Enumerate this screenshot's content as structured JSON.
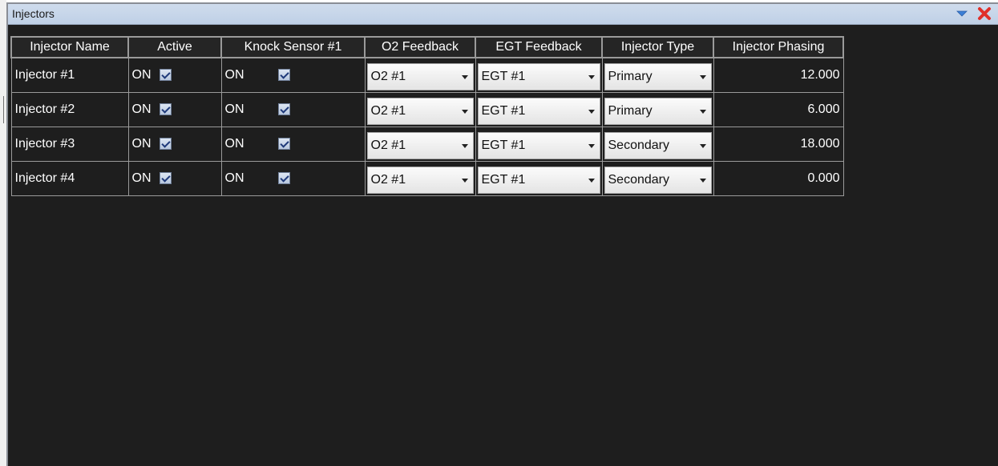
{
  "window": {
    "title": "Injectors"
  },
  "table": {
    "columns": [
      "Injector Name",
      "Active",
      "Knock Sensor #1",
      "O2 Feedback",
      "EGT Feedback",
      "Injector Type",
      "Injector Phasing"
    ],
    "rows": [
      {
        "name": "Injector #1",
        "active_label": "ON",
        "active_checked": true,
        "knock_label": "ON",
        "knock_checked": true,
        "o2": "O2 #1",
        "egt": "EGT #1",
        "type": "Primary",
        "phasing": "12.000"
      },
      {
        "name": "Injector #2",
        "active_label": "ON",
        "active_checked": true,
        "knock_label": "ON",
        "knock_checked": true,
        "o2": "O2 #1",
        "egt": "EGT #1",
        "type": "Primary",
        "phasing": "6.000"
      },
      {
        "name": "Injector #3",
        "active_label": "ON",
        "active_checked": true,
        "knock_label": "ON",
        "knock_checked": true,
        "o2": "O2 #1",
        "egt": "EGT #1",
        "type": "Secondary",
        "phasing": "18.000"
      },
      {
        "name": "Injector #4",
        "active_label": "ON",
        "active_checked": true,
        "knock_label": "ON",
        "knock_checked": true,
        "o2": "O2 #1",
        "egt": "EGT #1",
        "type": "Secondary",
        "phasing": "0.000"
      }
    ]
  },
  "icons": {
    "dropdown": "chevron-down-icon",
    "close": "close-icon"
  },
  "colors": {
    "panel_background": "#1e1e1e",
    "titlebar": "#c6d6eb",
    "close_red": "#e0302a",
    "dropdown_blue": "#3b7fd6"
  }
}
